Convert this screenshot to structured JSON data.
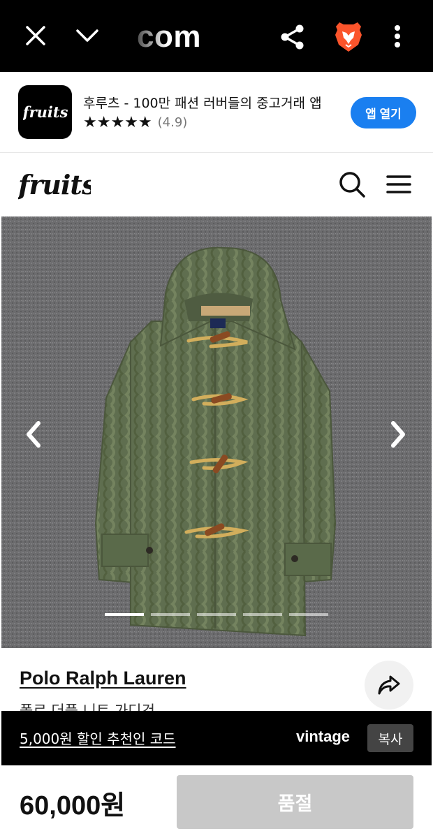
{
  "browser": {
    "url_fragment": "com"
  },
  "app_banner": {
    "title": "후루츠 - 100만 패션 러버들의 중고거래 앱",
    "stars": "★★★★★",
    "rating": "(4.9)",
    "open_label": "앱 열기"
  },
  "product": {
    "brand": "Polo Ralph Lauren",
    "title": "폴로 더플 니트 가디건",
    "image_count": 5,
    "current_image": 1,
    "price": "60,000원",
    "status_button": "품절"
  },
  "promo": {
    "text": "5,000원 할인 추천인 코드",
    "code": "vintage",
    "copy_label": "복사"
  },
  "colors": {
    "accent_blue": "#1a7ff0",
    "sold_out_gray": "#c8c8c8",
    "bar_black": "#000000"
  }
}
